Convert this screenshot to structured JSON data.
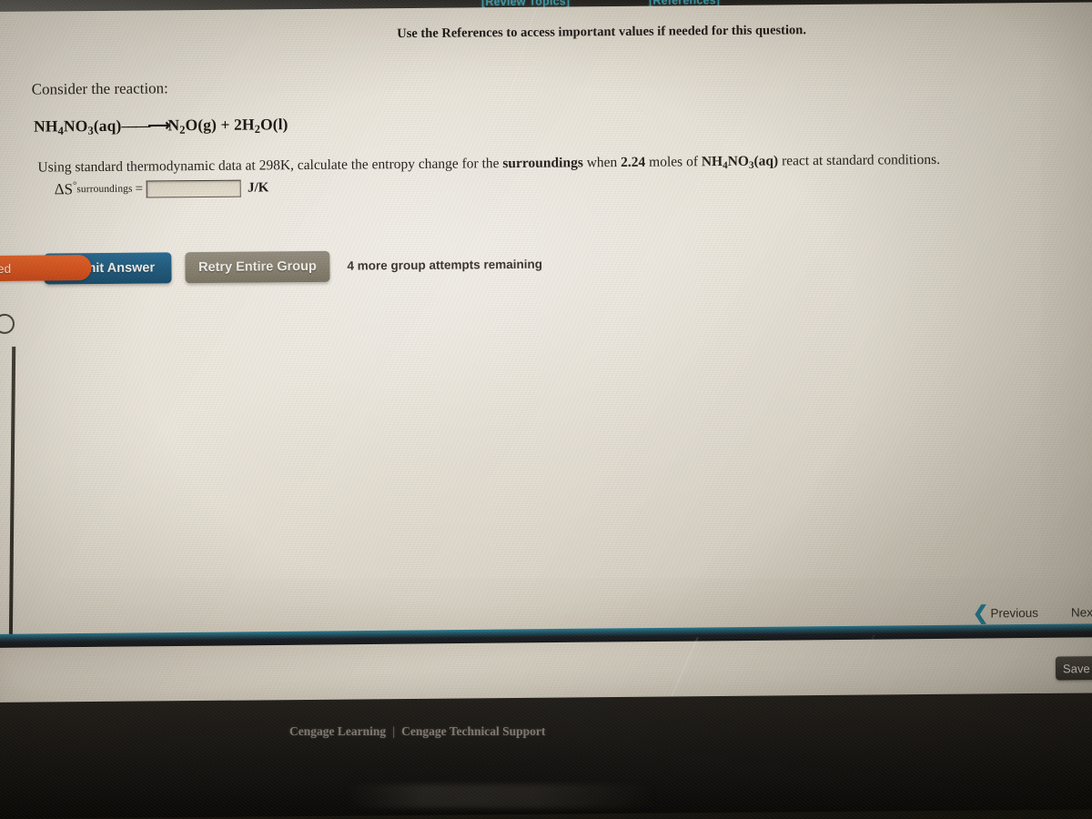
{
  "browser_bar": {
    "review_topics": "[Review Topics]",
    "references": "[References]"
  },
  "question": {
    "reference_note": "Use the References to access important values if needed for this question.",
    "consider_line": "Consider the reaction:",
    "equation": {
      "reactant": "NH₄NO₃(aq)",
      "arrow": "⟶",
      "products": "N₂O(g) + 2H₂O(l)",
      "full_text": "NH4NO3(aq) ⟶ N2O(g) + 2H2O(l)"
    },
    "prompt_part1": "Using standard thermodynamic data at 298K, calculate the entropy change for the ",
    "prompt_bold1": "surroundings",
    "prompt_part2": " when ",
    "prompt_moles": "2.24",
    "prompt_part3": " moles of ",
    "prompt_formula": "NH4NO3(aq)",
    "prompt_part4": " react at standard conditions.",
    "answer_symbol": "ΔS°",
    "answer_subscript": "surroundings",
    "equals": "=",
    "answer_value": "",
    "answer_placeholder": "",
    "unit": "J/K"
  },
  "actions": {
    "mastered_badge": "Mastered",
    "submit_label": "Submit Answer",
    "submit_visible_text": "mit Answer",
    "retry_label": "Retry Entire Group",
    "attempts_text": "4 more group attempts remaining"
  },
  "navigation": {
    "previous": "Previous",
    "next": "Next",
    "prev_chevron": "❮",
    "next_chevron": "❯",
    "save_label": "Save a"
  },
  "footer": {
    "learning_link": "Cengage Learning",
    "separator": "|",
    "support_link": "Cengage Technical Support"
  },
  "colors": {
    "link_teal": "#3c9aa8",
    "submit_blue": "#215a7d",
    "mastered_orange": "#d9551f",
    "retry_gray": "#87806f",
    "page_cream": "#e2dbcd",
    "nav_chevron": "#1f7d96"
  }
}
